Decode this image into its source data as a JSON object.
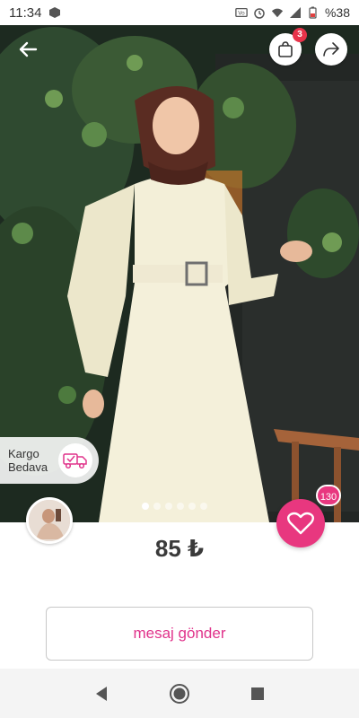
{
  "status_bar": {
    "time": "11:34",
    "battery": "%38",
    "icons": [
      "cube-icon",
      "volte-icon",
      "alarm-icon",
      "wifi-icon",
      "signal-icon",
      "battery-icon"
    ]
  },
  "header": {
    "back_icon": "arrow-left-icon",
    "cart_icon": "shopping-bag-icon",
    "cart_count": "3",
    "share_icon": "share-icon"
  },
  "product": {
    "shipping_badge": {
      "line1": "Kargo",
      "line2": "Bedava",
      "icon": "truck-check-icon"
    },
    "image_count": 6,
    "active_image": 0,
    "price": "85 ₺",
    "likes": "130"
  },
  "actions": {
    "message_label": "mesaj gönder"
  },
  "colors": {
    "accent_pink": "#e8377f",
    "badge_red": "#e8334a",
    "message_text": "#e0338b"
  },
  "nav": {
    "back_icon": "triangle-back-icon",
    "home_icon": "circle-home-icon",
    "recents_icon": "square-recents-icon"
  }
}
